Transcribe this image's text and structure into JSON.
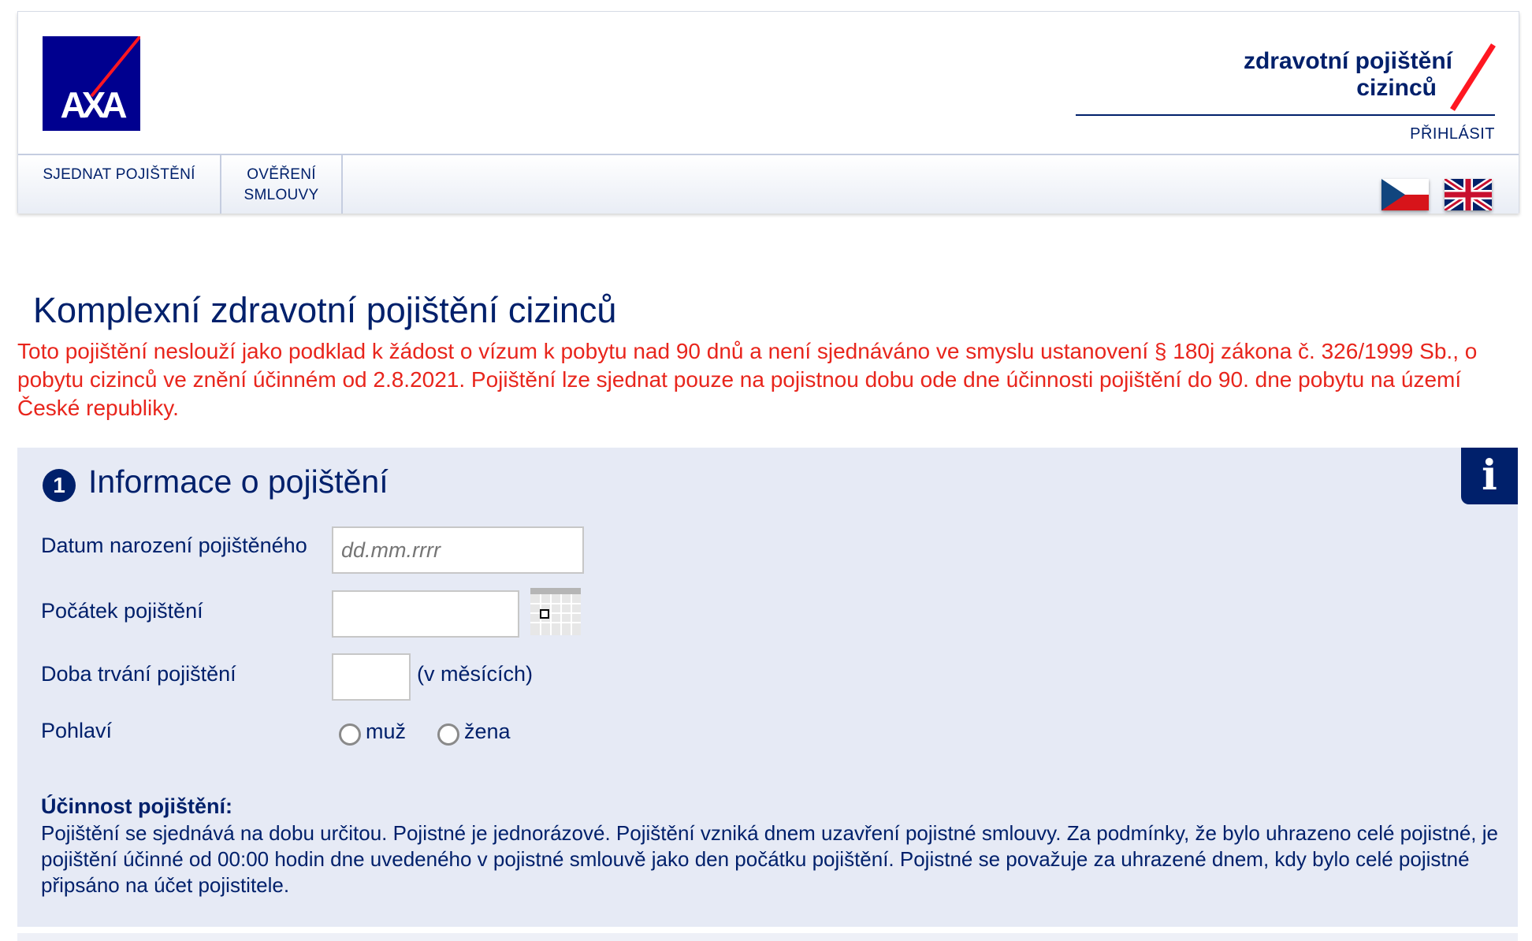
{
  "header": {
    "logo_text": "AXA",
    "brand_line1": "zdravotní pojištění",
    "brand_line2": "cizinců",
    "login": "PŘIHLÁSIT"
  },
  "nav": {
    "items": [
      {
        "line1": "SJEDNAT POJIŠTĚNÍ",
        "line2": ""
      },
      {
        "line1": "OVĚŘENÍ",
        "line2": "SMLOUVY"
      }
    ],
    "flags": [
      "czech-flag-icon",
      "uk-flag-icon"
    ]
  },
  "main": {
    "title": "Komplexní zdravotní pojištění cizinců",
    "warning": "Toto pojištění neslouží jako podklad k žádost o vízum k pobytu nad 90 dnů a není sjednáváno ve smyslu ustanovení § 180j zákona č. 326/1999 Sb., o pobytu cizinců ve znění účinném od 2.8.2021. Pojištění lze sjednat pouze na pojistnou dobu ode dne účinnosti pojištění do 90. dne pobytu na území České republiky."
  },
  "section1": {
    "step": "1",
    "title": "Informace o pojištění",
    "info_icon": "i",
    "birthdate_label": "Datum narození pojištěného",
    "birthdate_placeholder": "dd.mm.rrrr",
    "birthdate_value": "",
    "start_label": "Počátek pojištění",
    "start_value": "",
    "duration_label": "Doba trvání pojištění",
    "duration_value": "",
    "duration_suffix": "(v měsících)",
    "gender_label": "Pohlaví",
    "gender_options": [
      "muž",
      "žena"
    ],
    "effectiveness_title": "Účinnost pojištění:",
    "effectiveness_text": "Pojištění se sjednává na dobu určitou. Pojistné je jednorázové. Pojištění vzniká dnem uzavření pojistné smlouvy. Za podmínky, že bylo uhrazeno celé pojistné, je pojištění účinné od 00:00 hodin dne uvedeného v pojistné smlouvě jako den počátku pojištění. Pojistné se považuje za uhrazené dnem, kdy bylo celé pojistné připsáno na účet pojistitele."
  },
  "colors": {
    "brand_blue": "#00206b",
    "accent_red": "#e8251c",
    "panel_bg": "#e6eaf5"
  }
}
